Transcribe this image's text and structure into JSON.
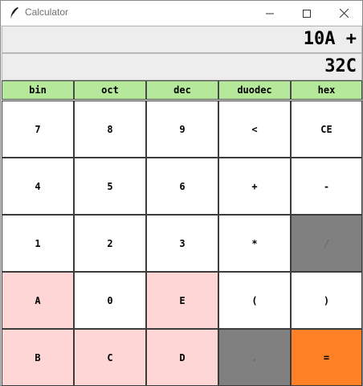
{
  "window": {
    "title": "Calculator",
    "icon": "feather-icon",
    "controls": [
      "minimize-icon",
      "maximize-icon",
      "close-icon"
    ]
  },
  "display": {
    "expression": "10A +",
    "result": "32C"
  },
  "bases": [
    {
      "label": "bin",
      "selected": false
    },
    {
      "label": "oct",
      "selected": false
    },
    {
      "label": "dec",
      "selected": false
    },
    {
      "label": "duodec",
      "selected": true
    },
    {
      "label": "hex",
      "selected": false
    }
  ],
  "keys": [
    [
      "7",
      "8",
      "9",
      "<",
      "CE"
    ],
    [
      "4",
      "5",
      "6",
      "+",
      "-"
    ],
    [
      "1",
      "2",
      "3",
      "*",
      "/"
    ],
    [
      "A",
      "0",
      "E",
      "(",
      ")"
    ],
    [
      "B",
      "C",
      "D",
      ".",
      "="
    ]
  ],
  "colors": {
    "base_tab": "#b6e89c",
    "digit_key": "#ffffff",
    "hex_digit_key": "#ffd6d6",
    "disabled_key": "#808080",
    "equals_key": "#ff8126"
  }
}
